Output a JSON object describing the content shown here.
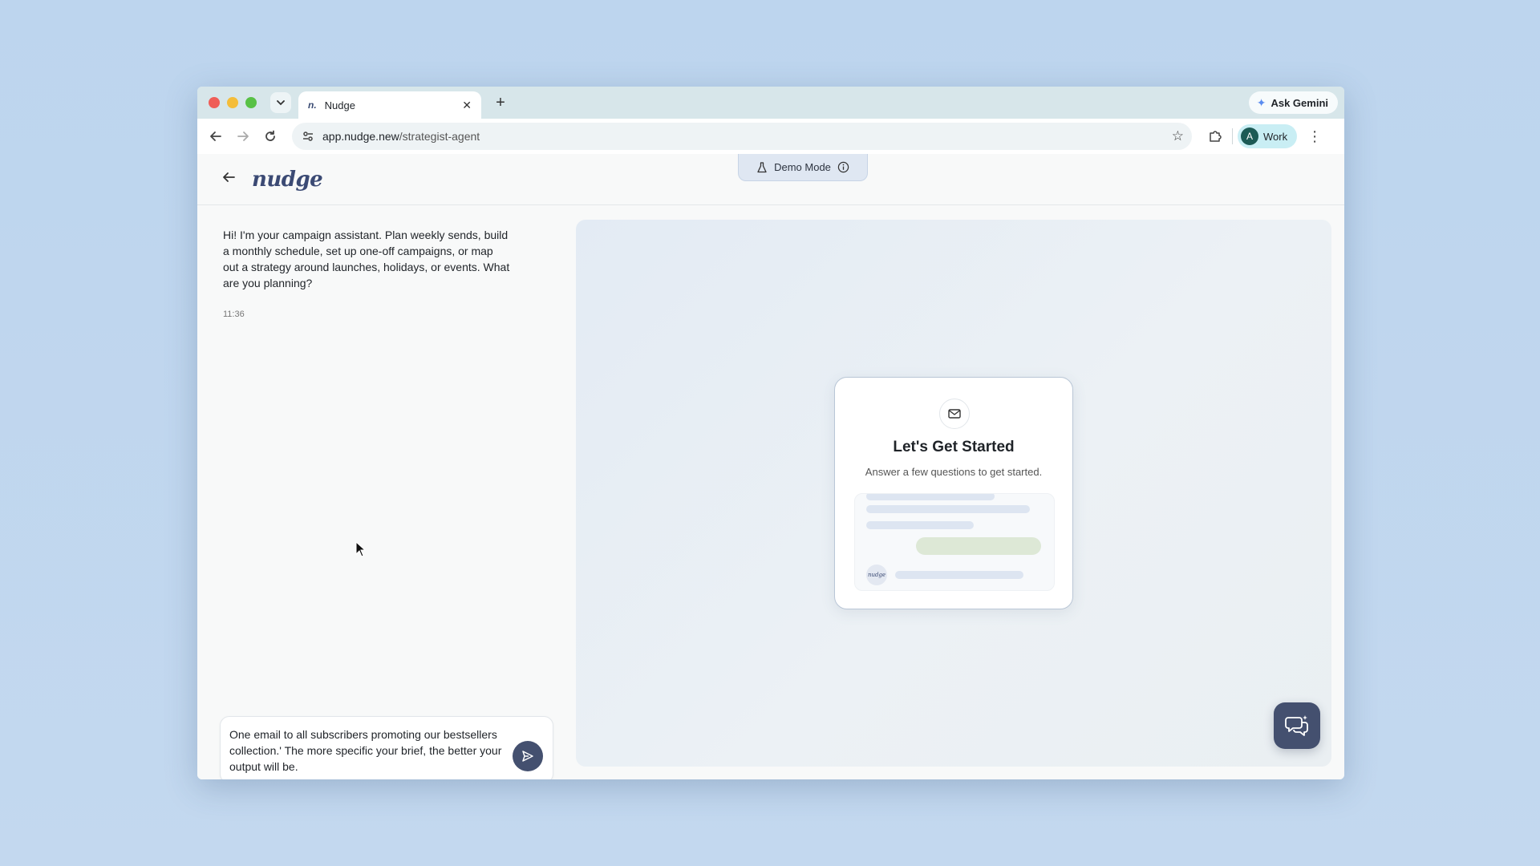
{
  "browser": {
    "tab_title": "Nudge",
    "tab_favicon": "n.",
    "ask_gemini": "Ask Gemini",
    "url_domain": "app.nudge.new",
    "url_path": "/strategist-agent",
    "profile_initial": "A",
    "profile_label": "Work"
  },
  "app": {
    "logo": "nudge",
    "demo_mode_label": "Demo Mode",
    "chat": {
      "assistant_message": "Hi! I'm your campaign assistant. Plan weekly sends, build a monthly schedule, set up one-off campaigns, or map out a strategy around launches, holidays, or events. What are you planning?",
      "assistant_time": "11:36",
      "composer_text": "One email to all subscribers promoting our bestsellers collection.' The more specific your brief, the better your output will be."
    },
    "preview": {
      "card_title": "Let's Get Started",
      "card_subtitle": "Answer a few questions to get started.",
      "mini_logo": "nudge"
    }
  },
  "colors": {
    "accent": "#44506f",
    "brand": "#3b4a74"
  },
  "icons": {
    "tab_search": "chevron-down-icon",
    "new_tab": "plus-icon",
    "back": "arrow-left-icon",
    "forward": "arrow-right-icon",
    "reload": "reload-icon",
    "site_info": "tune-icon",
    "bookmark": "star-icon",
    "extensions": "puzzle-icon",
    "menu": "kebab-icon",
    "demo": "flask-icon",
    "info": "info-icon",
    "mail": "mail-icon",
    "send": "send-icon",
    "chat_fab": "chat-bubbles-icon"
  }
}
